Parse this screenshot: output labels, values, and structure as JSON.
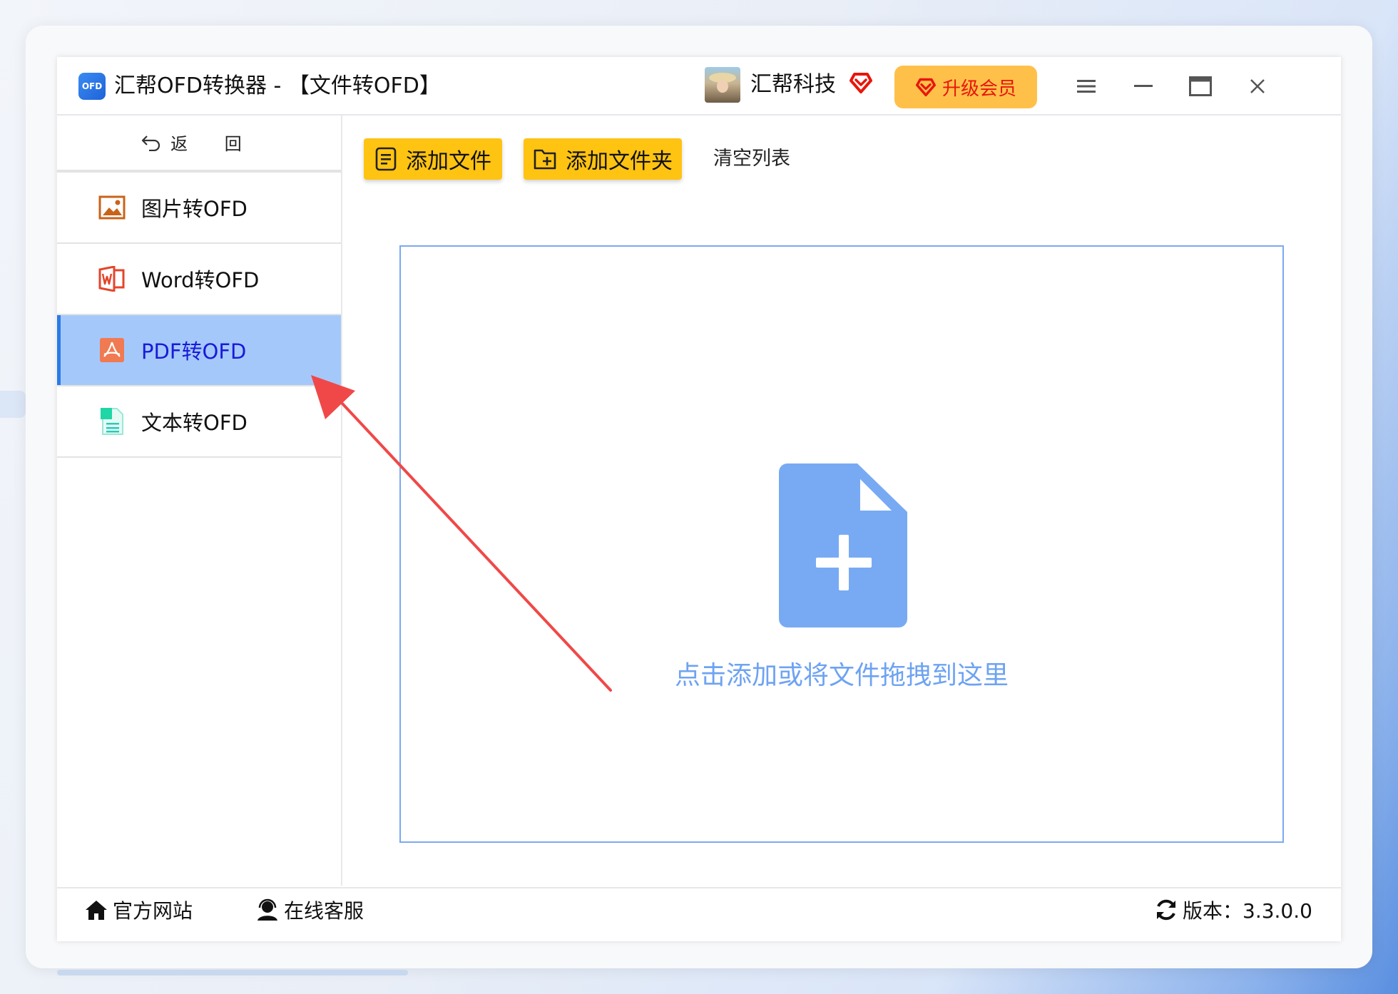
{
  "window": {
    "logo_text": "OFD",
    "title": "汇帮OFD转换器 - 【文件转OFD】",
    "user_name": "汇帮科技",
    "upgrade_label": "升级会员"
  },
  "sidebar": {
    "back_label": "返 回",
    "items": [
      {
        "label": "图片转OFD",
        "icon": "image-icon"
      },
      {
        "label": "Word转OFD",
        "icon": "word-icon"
      },
      {
        "label": "PDF转OFD",
        "icon": "pdf-icon",
        "active": true
      },
      {
        "label": "文本转OFD",
        "icon": "text-file-icon"
      }
    ]
  },
  "toolbar": {
    "add_file_label": "添加文件",
    "add_folder_label": "添加文件夹",
    "clear_label": "清空列表"
  },
  "dropzone": {
    "hint": "点击添加或将文件拖拽到这里"
  },
  "footer": {
    "website_label": "官方网站",
    "service_label": "在线客服",
    "version_label": "版本：3.3.0.0"
  },
  "colors": {
    "accent_yellow": "#ffc312",
    "active_nav": "#a5c8fb",
    "dropzone_blue": "#7aaaf0",
    "annotation_red": "#f04848"
  }
}
